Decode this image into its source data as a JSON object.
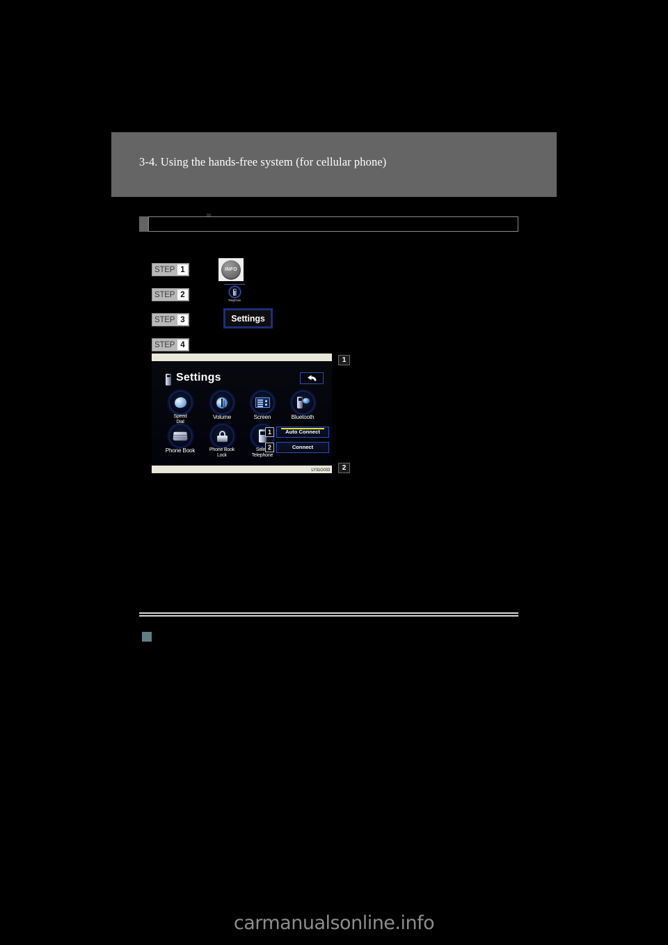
{
  "page": {
    "background_color": "#000000",
    "chapter_heading": "3-4. Using the hands-free system (for cellular phone)",
    "watermark": "carmanualsonline.info",
    "figure_code": "LY31G033"
  },
  "section_bar": {
    "label": "",
    "border_color": "#8a8a8a"
  },
  "steps": [
    {
      "word": "STEP",
      "number": "1"
    },
    {
      "word": "STEP",
      "number": "2"
    },
    {
      "word": "STEP",
      "number": "3"
    },
    {
      "word": "STEP",
      "number": "4"
    }
  ],
  "step_graphics": {
    "info_button": {
      "label": "INFO",
      "icon": "info-knob-icon"
    },
    "telephone_button": {
      "label": "Telephone",
      "icon": "telephone-handset-icon"
    },
    "settings_button": {
      "label": "Settings",
      "border_color": "#1b2f7a"
    }
  },
  "nav_screen": {
    "title": "Settings",
    "title_icon": "cellular-phone-icon",
    "back_button_icon": "back-arrow-icon",
    "items": [
      {
        "label": "Speed\nDial",
        "label_line1": "Speed",
        "label_line2": "Dial",
        "icon": "speed-dial-icon"
      },
      {
        "label": "Volume",
        "icon": "volume-icon"
      },
      {
        "label": "Screen",
        "icon": "screen-icon"
      },
      {
        "label": "Bluetooth",
        "icon": "bluetooth-phone-icon"
      },
      {
        "label": "Phone Book",
        "icon": "phone-book-icon"
      },
      {
        "label": "Phone Book\nLock",
        "label_line1": "Phone Book",
        "label_line2": "Lock",
        "icon": "phone-book-lock-icon"
      },
      {
        "label": "Select\nTelephone",
        "label_line1": "Select",
        "label_line2": "Telephone",
        "icon": "select-telephone-icon"
      }
    ],
    "connect_buttons": [
      {
        "badge": "1",
        "label": "Auto Connect",
        "highlighted": true,
        "highlight_color": "#e8e534"
      },
      {
        "badge": "2",
        "label": "Connect",
        "highlighted": false
      }
    ]
  },
  "callouts": [
    {
      "number": "1"
    },
    {
      "number": "2"
    }
  ]
}
